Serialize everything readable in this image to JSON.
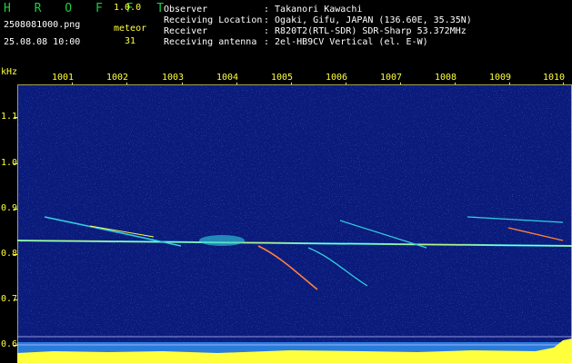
{
  "header": {
    "app_name": "H R O F F T",
    "version": "1.0.0",
    "filename": "2508081000.png",
    "datetime": "25.08.08 10:00",
    "meteor_label": "meteor",
    "meteor_count": "31",
    "fields": [
      {
        "label": "Observer",
        "value": ": Takanori Kawachi"
      },
      {
        "label": "Receiving Location",
        "value": ": Ogaki, Gifu, JAPAN (136.60E, 35.35N)"
      },
      {
        "label": "Receiver",
        "value": ": R820T2(RTL-SDR) SDR-Sharp 53.372MHz"
      },
      {
        "label": "Receiving antenna",
        "value": ": 2el-HB9CV Vertical (el. E-W)"
      }
    ]
  },
  "spectrogram": {
    "y_unit": "kHz",
    "y_ticks": [
      "1.1",
      "1.0",
      "0.9",
      "0.8",
      "0.7",
      "0.6"
    ],
    "x_ticks": [
      "1001",
      "1002",
      "1003",
      "1004",
      "1005",
      "1006",
      "1007",
      "1008",
      "1009",
      "1010"
    ],
    "colors": {
      "background": "#0a1a7a",
      "axis": "#ffff3c",
      "signal_high": "#ffff50",
      "signal_mid": "#30d0e0"
    }
  }
}
